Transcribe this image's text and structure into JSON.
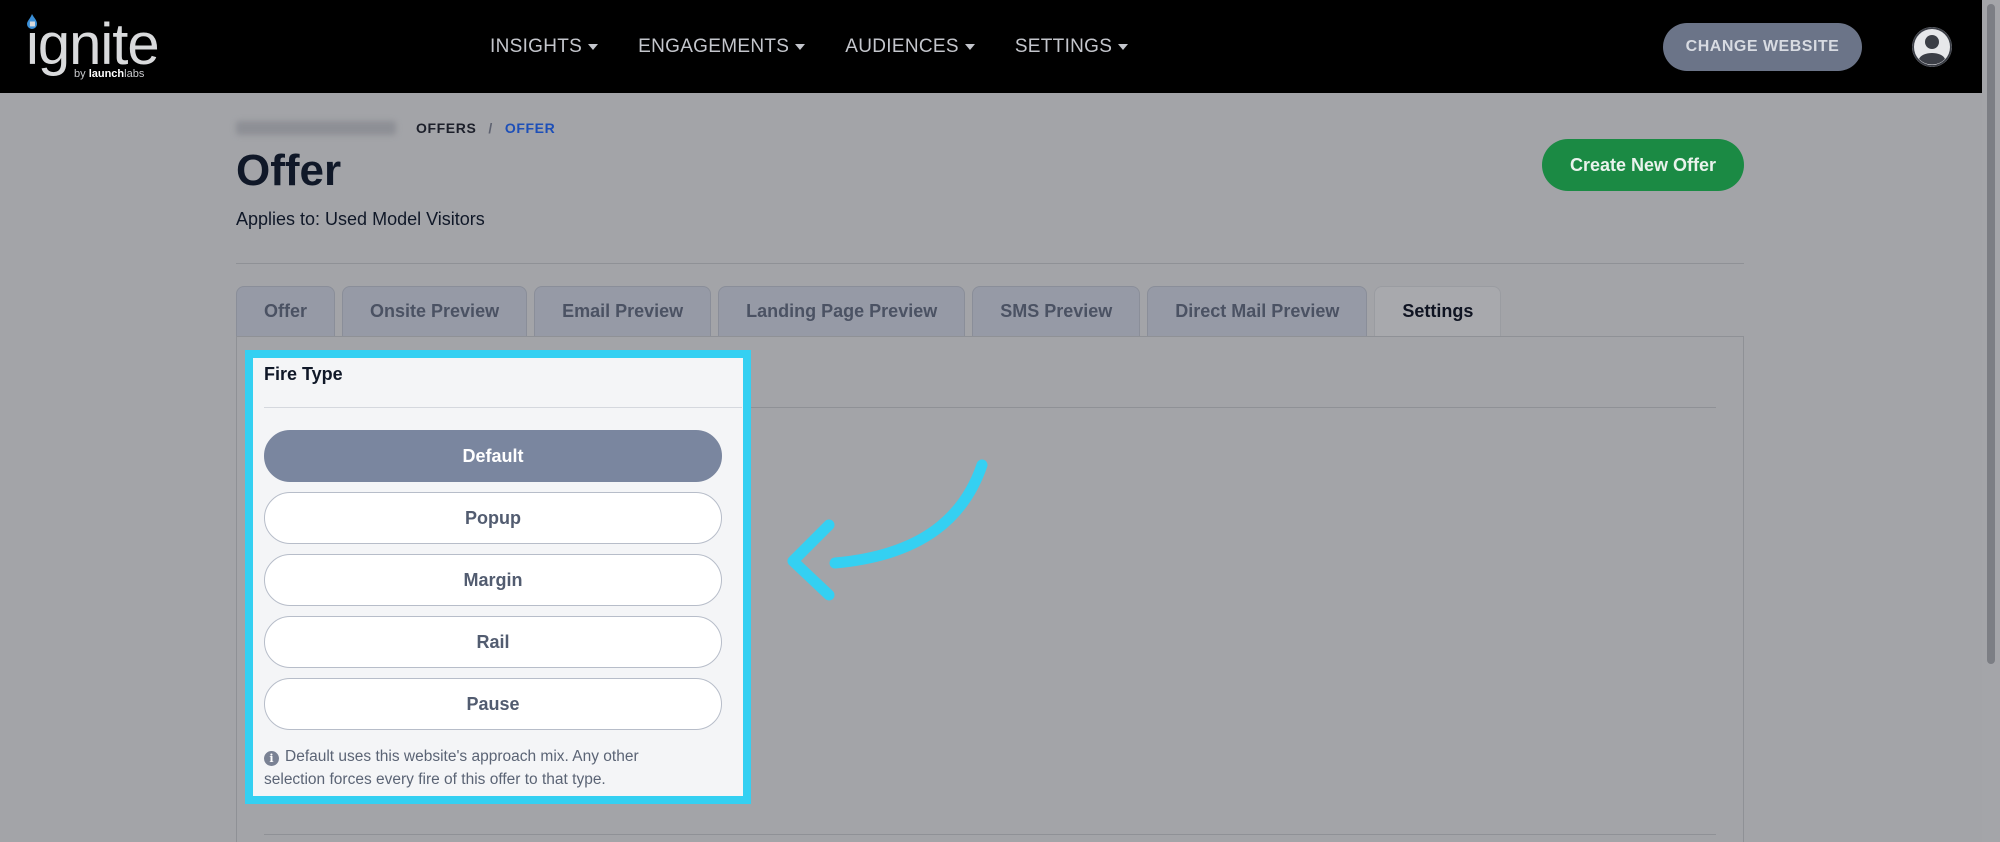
{
  "logo": {
    "word": "ignite",
    "by": "by ",
    "brand_bold": "launch",
    "brand_light": "labs"
  },
  "nav": {
    "items": [
      {
        "label": "INSIGHTS"
      },
      {
        "label": "ENGAGEMENTS"
      },
      {
        "label": "AUDIENCES"
      },
      {
        "label": "SETTINGS"
      }
    ],
    "change_website": "CHANGE WEBSITE"
  },
  "breadcrumb": {
    "items": [
      "OFFERS"
    ],
    "separator": "/",
    "current": "OFFER"
  },
  "page": {
    "title": "Offer",
    "applies_to": "Applies to: Used Model Visitors",
    "create_button": "Create New Offer"
  },
  "tabs": [
    {
      "label": "Offer"
    },
    {
      "label": "Onsite Preview"
    },
    {
      "label": "Email Preview"
    },
    {
      "label": "Landing Page Preview"
    },
    {
      "label": "SMS Preview"
    },
    {
      "label": "Direct Mail Preview"
    },
    {
      "label": "Settings",
      "active": true
    }
  ],
  "fire_type": {
    "title": "Fire Type",
    "options": [
      "Default",
      "Popup",
      "Margin",
      "Rail",
      "Pause"
    ],
    "selected": "Default",
    "help_text": "Default uses this website's approach mix. Any other selection forces every fire of this offer to that type."
  },
  "colors": {
    "highlight": "#34d0f2",
    "create_button": "#1b8a44",
    "selected_option": "#7a869f",
    "breadcrumb_current": "#1d4fb8"
  },
  "icons": {
    "info": "info-circle-icon",
    "caret": "caret-down-icon",
    "avatar": "user-circle-icon",
    "annotation": "curved-arrow-icon"
  }
}
